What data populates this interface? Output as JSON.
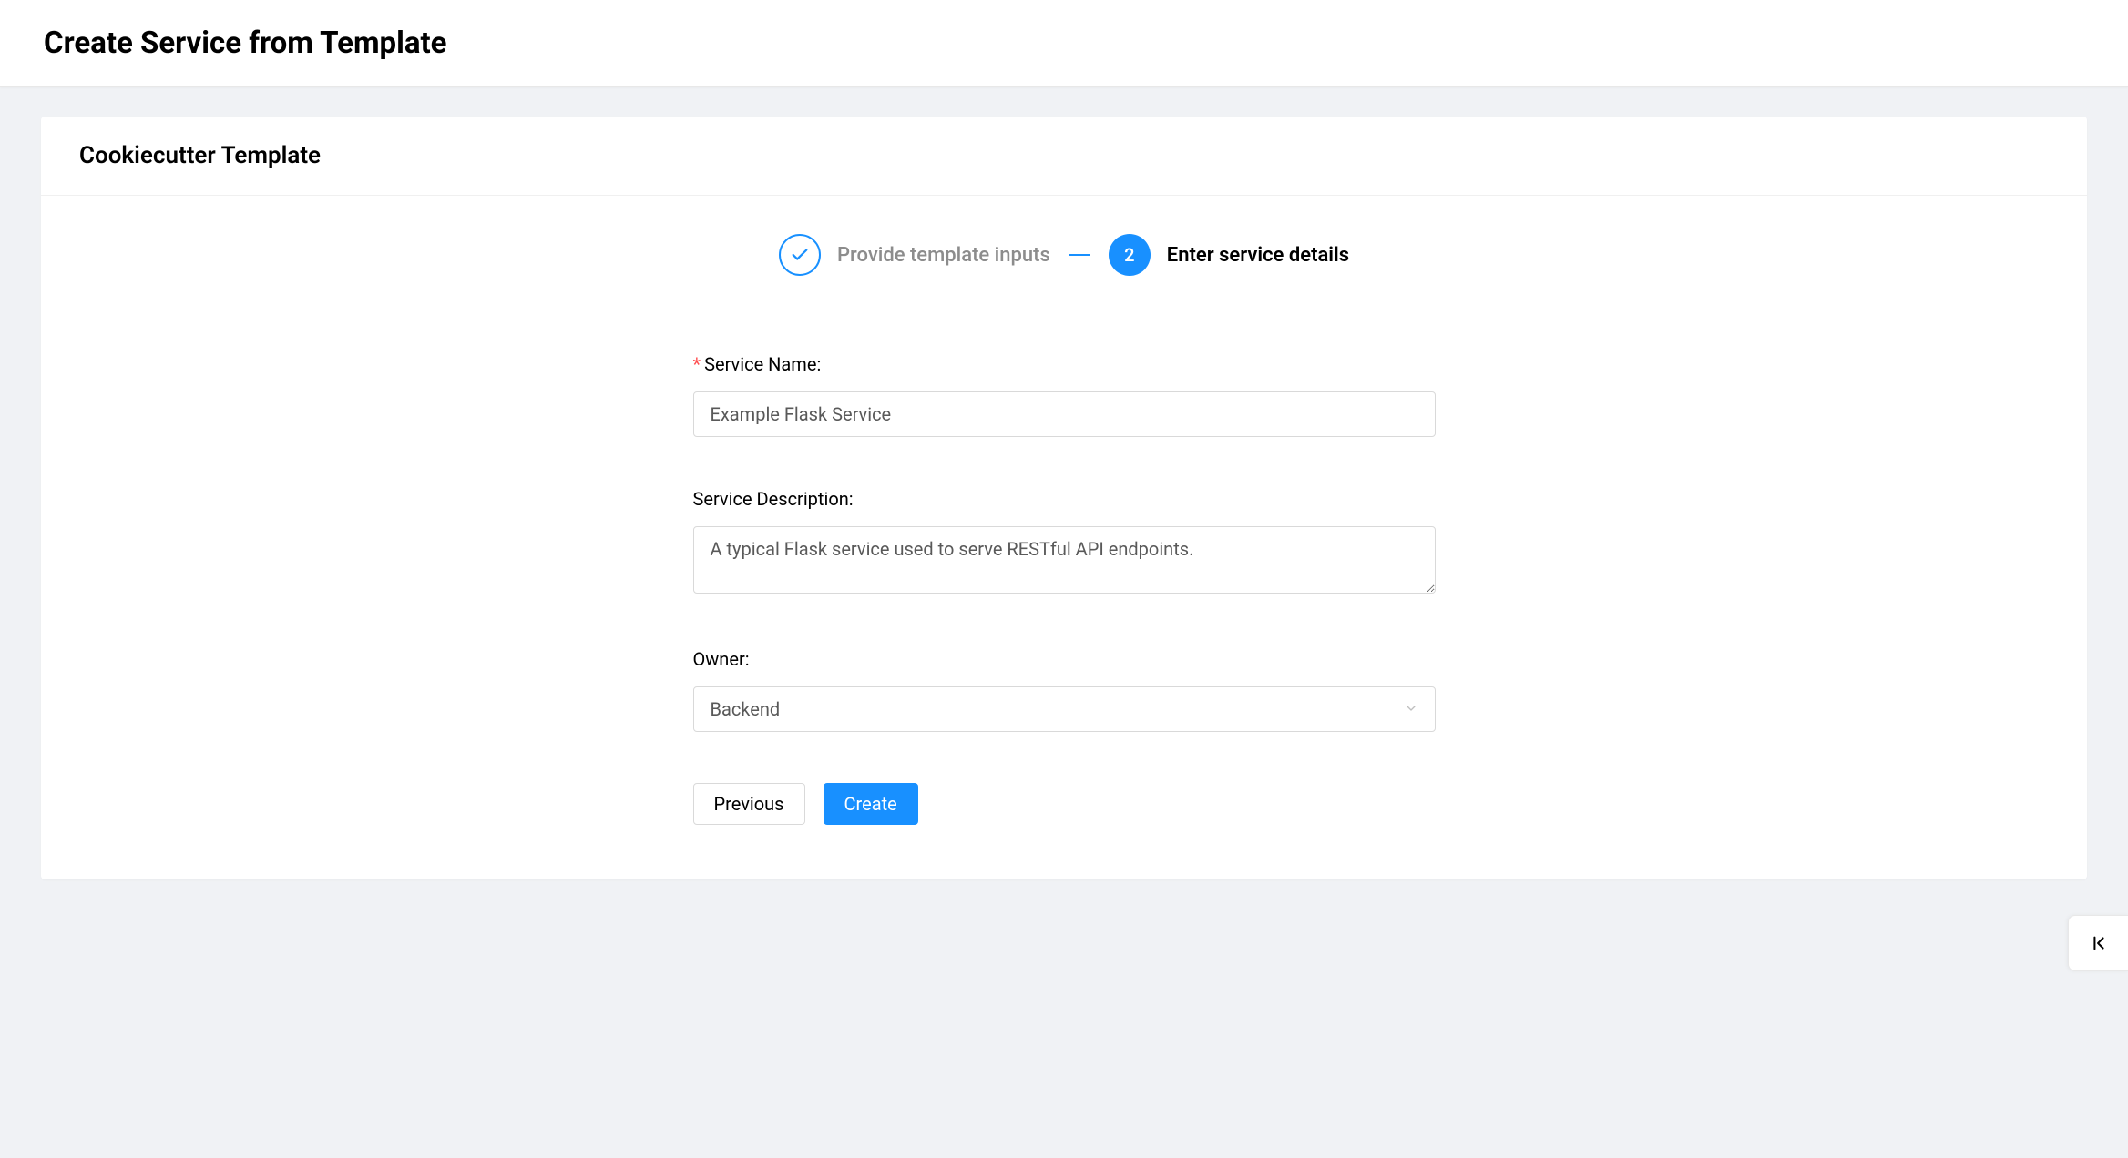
{
  "header": {
    "title": "Create Service from Template"
  },
  "card": {
    "title": "Cookiecutter Template"
  },
  "steps": [
    {
      "label": "Provide template inputs",
      "state": "completed"
    },
    {
      "number": "2",
      "label": "Enter service details",
      "state": "active"
    }
  ],
  "form": {
    "service_name": {
      "label": "Service Name",
      "value": "Example Flask Service",
      "required": true
    },
    "service_description": {
      "label": "Service Description",
      "value": "A typical Flask service used to serve RESTful API endpoints."
    },
    "owner": {
      "label": "Owner",
      "value": "Backend"
    }
  },
  "buttons": {
    "previous": "Previous",
    "create": "Create"
  },
  "punctuation": {
    "colon": ":",
    "asterisk": "*"
  }
}
